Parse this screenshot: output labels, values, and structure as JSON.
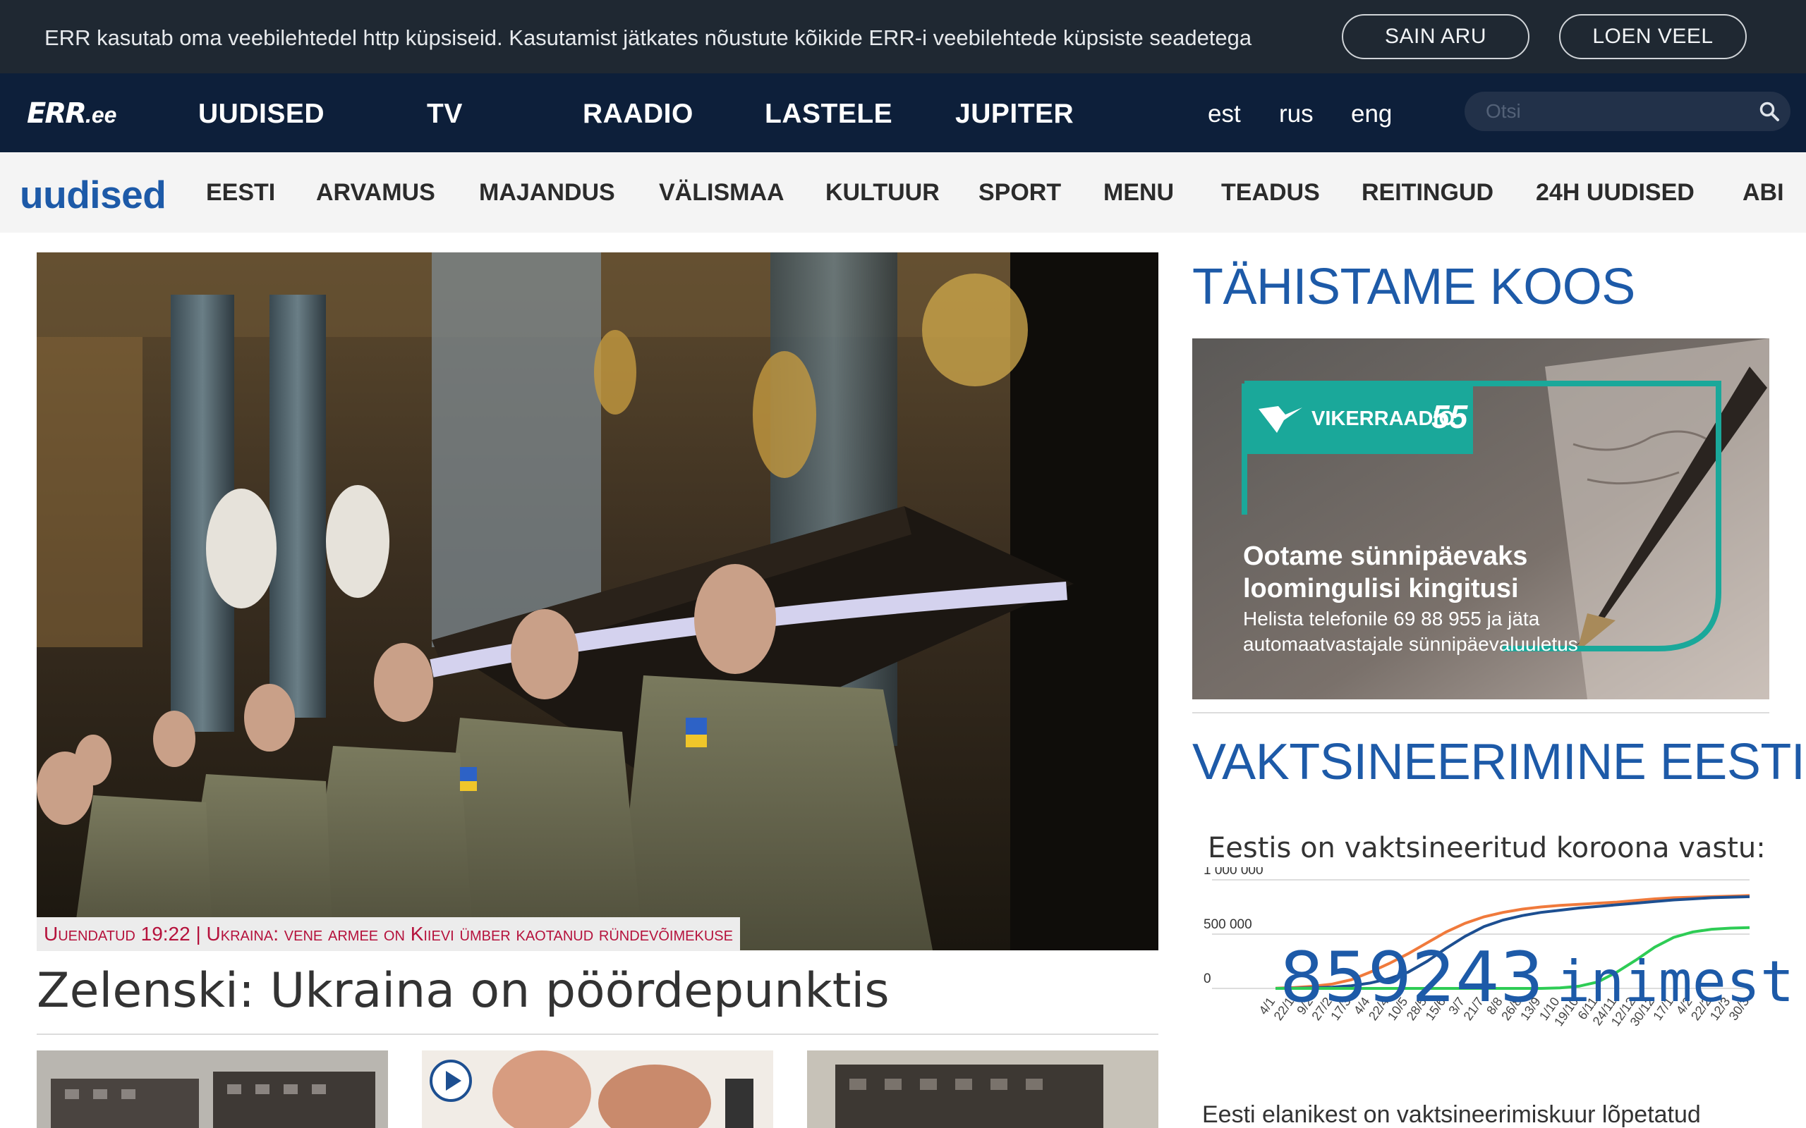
{
  "cookie": {
    "text": "ERR kasutab oma veebilehtedel http küpsiseid. Kasutamist jätkates nõustute kõikide ERR-i veebilehtede küpsiste seadetega",
    "agree_label": "SAIN ARU",
    "more_label": "LOEN VEEL"
  },
  "topnav": {
    "logo_main": "ERR",
    "logo_suffix": ".ee",
    "items": [
      "UUDISED",
      "TV",
      "RAADIO",
      "LASTELE",
      "JUPITER"
    ],
    "languages": [
      "est",
      "rus",
      "eng"
    ],
    "search_placeholder": "Otsi"
  },
  "section": {
    "brand": "uudised",
    "items": [
      "EESTI",
      "ARVAMUS",
      "MAJANDUS",
      "VÄLISMAA",
      "KULTUUR",
      "SPORT",
      "MENU",
      "TEADUS",
      "REITINGUD",
      "24H UUDISED",
      "ABI"
    ]
  },
  "hero": {
    "caption": "Uuendatud 19:22 | Ukraina: vene armee on Kiievi ümber kaotanud ründevõimekuse",
    "headline": "Zelenski: Ukraina on pöördepunktis"
  },
  "sidebar": {
    "title1": "TÄHISTAME KOOS",
    "promo": {
      "logo_text": "VIKERRAADIO",
      "logo_num": "55",
      "headline": "Ootame sünnipäevaks loomingulisi kingitusi",
      "sub": "Helista telefonile 69 88 955 ja jäta automaatvastajale sünnipäevaluuletus"
    },
    "title2": "VAKTSINEERIMINE EESTIS",
    "vax_heading": "Eestis on vaktsineeritud koroona vastu:",
    "vax_number": "859243",
    "vax_unit": "inimest",
    "vax_footer": "Eesti elanikest on vaktsineerimiskuur lõpetatud"
  },
  "chart_data": {
    "type": "line",
    "title": "Eestis on vaktsineeritud koroona vastu:",
    "y_ticks": [
      "1 000 000",
      "500 000",
      "0"
    ],
    "ylim": [
      0,
      1000000
    ],
    "x": [
      "4/1",
      "22/1",
      "9/2",
      "27/2",
      "17/3",
      "4/4",
      "22/4",
      "10/5",
      "28/5",
      "15/6",
      "3/7",
      "21/7",
      "8/8",
      "26/8",
      "13/9",
      "1/10",
      "19/10",
      "6/11",
      "24/11",
      "12/12",
      "30/12",
      "17/1",
      "4/2",
      "22/2",
      "12/3",
      "30/3"
    ],
    "series": [
      {
        "color": "#f07a3c",
        "values": [
          2000,
          8000,
          20000,
          40000,
          80000,
          150000,
          230000,
          320000,
          420000,
          520000,
          600000,
          660000,
          700000,
          730000,
          750000,
          765000,
          775000,
          785000,
          795000,
          810000,
          825000,
          835000,
          840000,
          845000,
          850000,
          855000
        ]
      },
      {
        "color": "#1d4f91",
        "values": [
          0,
          2000,
          6000,
          12000,
          25000,
          50000,
          90000,
          150000,
          250000,
          370000,
          480000,
          570000,
          630000,
          670000,
          700000,
          720000,
          740000,
          755000,
          770000,
          785000,
          800000,
          815000,
          825000,
          835000,
          840000,
          845000
        ]
      },
      {
        "color": "#2ecc55",
        "values": [
          0,
          0,
          0,
          0,
          0,
          0,
          0,
          0,
          0,
          0,
          0,
          0,
          0,
          0,
          0,
          5000,
          20000,
          60000,
          150000,
          260000,
          380000,
          470000,
          520000,
          545000,
          555000,
          560000
        ]
      }
    ]
  }
}
